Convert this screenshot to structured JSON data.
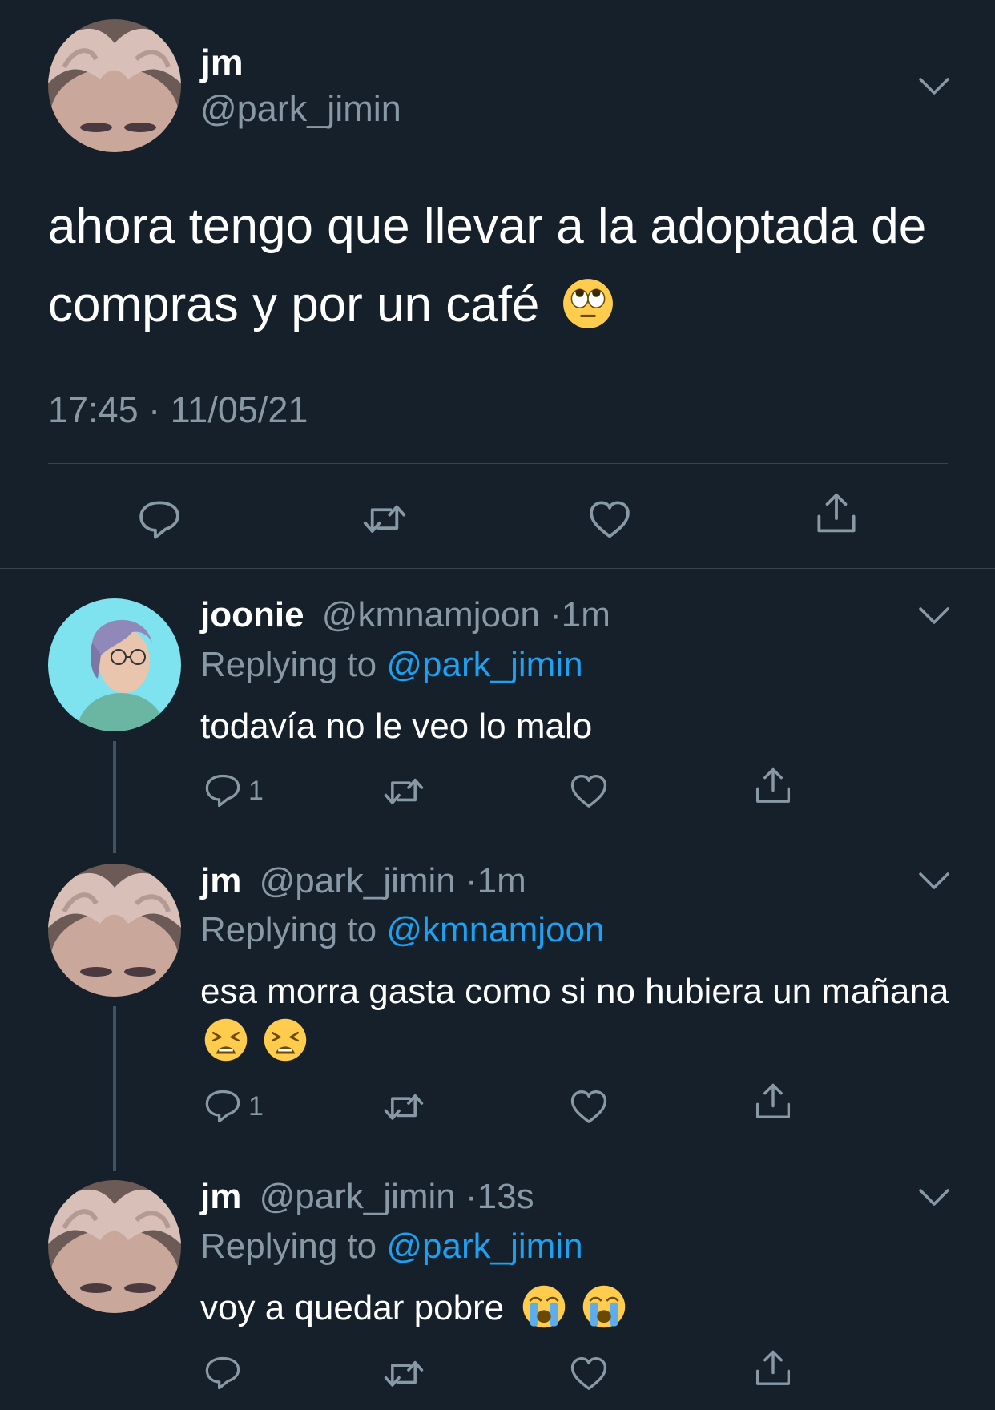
{
  "main_tweet": {
    "name": "jm",
    "handle": "@park_jimin",
    "text": "ahora tengo que llevar a la adoptada de compras y por un café",
    "emoji": "face-with-rolling-eyes",
    "timestamp": "17:45 · 11/05/21",
    "actions": [
      "reply",
      "retweet",
      "like",
      "share"
    ]
  },
  "replies": [
    {
      "name": "joonie",
      "handle": "@kmnamjoon",
      "dot": "·",
      "time": "1m",
      "replying_prefix": "Replying to",
      "replying_to": "@park_jimin",
      "text": "todavía no le veo lo malo",
      "emojis": [],
      "reply_count": "1"
    },
    {
      "name": "jm",
      "handle": "@park_jimin",
      "dot": "·",
      "time": "1m",
      "replying_prefix": "Replying to",
      "replying_to": "@kmnamjoon",
      "text": "esa morra gasta como si no hubiera un mañana",
      "emojis": [
        "tired-face",
        "tired-face"
      ],
      "reply_count": "1"
    },
    {
      "name": "jm",
      "handle": "@park_jimin",
      "dot": "·",
      "time": "13s",
      "replying_prefix": "Replying to",
      "replying_to": "@park_jimin",
      "text": "voy a quedar pobre",
      "emojis": [
        "loudly-crying-face",
        "loudly-crying-face"
      ],
      "reply_count": ""
    }
  ],
  "colors": {
    "background": "#15202b",
    "secondary_text": "#8899a6",
    "link": "#1da1f2",
    "divider": "#38444d"
  }
}
